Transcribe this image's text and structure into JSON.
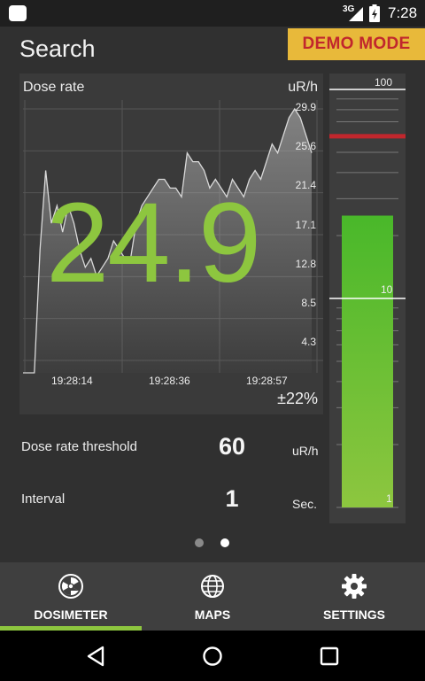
{
  "status_bar": {
    "network": "3G",
    "time": "7:28"
  },
  "header": {
    "title": "Search",
    "demo_badge": "DEMO MODE"
  },
  "chart_data": {
    "type": "line",
    "title": "Dose rate",
    "ylabel": "uR/h",
    "y_ticks": [
      "29.9",
      "25.6",
      "21.4",
      "17.1",
      "12.8",
      "8.5",
      "4.3"
    ],
    "x_ticks": [
      "19:28:14",
      "19:28:36",
      "19:28:57"
    ],
    "ylim": [
      0,
      30
    ],
    "grid": true,
    "series": [
      {
        "values": [
          0,
          0,
          0,
          14,
          23,
          17,
          19,
          16,
          19,
          17,
          14,
          12,
          13,
          11,
          12,
          13,
          15,
          14,
          13,
          13,
          17,
          19,
          20,
          21,
          22,
          22,
          21,
          21,
          20,
          25,
          24,
          24,
          23,
          21,
          22,
          21,
          20,
          22,
          21,
          20,
          22,
          23,
          22,
          24,
          26,
          25,
          27,
          29,
          30,
          29,
          27,
          25
        ]
      }
    ],
    "current_value": "24.9",
    "accuracy": "±22%"
  },
  "settings": {
    "threshold_label": "Dose rate threshold",
    "threshold_value": "60",
    "threshold_unit": "uR/h",
    "interval_label": "Interval",
    "interval_value": "1",
    "interval_unit": "Sec."
  },
  "meter": {
    "scale_labels": [
      "100",
      "10",
      "1"
    ],
    "level": 24.9,
    "threshold": 60,
    "fill_color": "#7bc237",
    "threshold_color": "#c1272d"
  },
  "pager": {
    "pages": 2,
    "active": 1
  },
  "tabs": [
    {
      "label": "DOSIMETER",
      "icon": "radiation-icon",
      "active": true
    },
    {
      "label": "MAPS",
      "icon": "globe-icon",
      "active": false
    },
    {
      "label": "SETTINGS",
      "icon": "gear-icon",
      "active": false
    }
  ],
  "colors": {
    "accent": "#8dc63f",
    "demo_badge_bg": "#e8b93a",
    "demo_badge_text": "#c1272d"
  }
}
